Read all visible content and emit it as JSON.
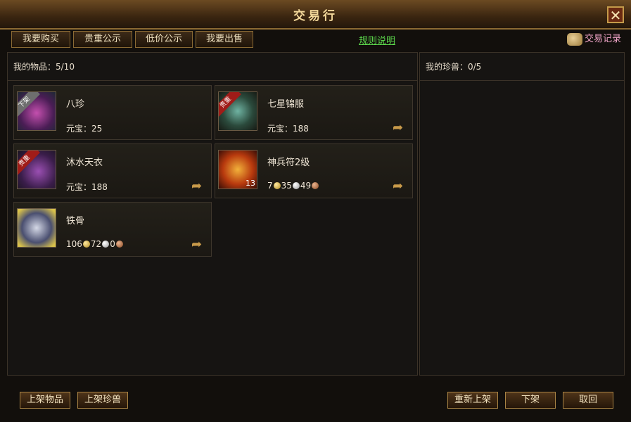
{
  "window": {
    "title": "交易行",
    "close_symbol": "✕"
  },
  "tabs": [
    {
      "label": "我要购买"
    },
    {
      "label": "贵重公示"
    },
    {
      "label": "低价公示"
    },
    {
      "label": "我要出售"
    }
  ],
  "rules_link": "规则说明",
  "record_link": "交易记录",
  "items_panel": {
    "label": "我的物品：5/10"
  },
  "pets_panel": {
    "label": "我的珍兽：0/5"
  },
  "items": [
    {
      "name": "八珍",
      "price": "元宝：25",
      "ribbon": "下架",
      "ribbon_color": "#6e6e6e",
      "icon": "pearl-ring-icon"
    },
    {
      "name": "七星锦服",
      "price": "元宝：188",
      "ribbon": "贵重",
      "ribbon_color": "#a01c18",
      "icon": "armor-icon"
    },
    {
      "name": "沐水天衣",
      "price": "元宝：188",
      "ribbon": "贵重",
      "ribbon_color": "#a01c18",
      "icon": "robe-icon"
    },
    {
      "name": "神兵符2级",
      "gold": "7",
      "silver": "35",
      "copper": "49",
      "count": "13",
      "icon": "dragon-talisman-icon"
    },
    {
      "name": "铁骨",
      "gold": "106",
      "silver": "72",
      "copper": "0",
      "icon": "iron-bone-icon"
    }
  ],
  "buttons": {
    "list_item": "上架物品",
    "list_pet": "上架珍兽",
    "relist": "重新上架",
    "delist": "下架",
    "cancel": "取回"
  }
}
